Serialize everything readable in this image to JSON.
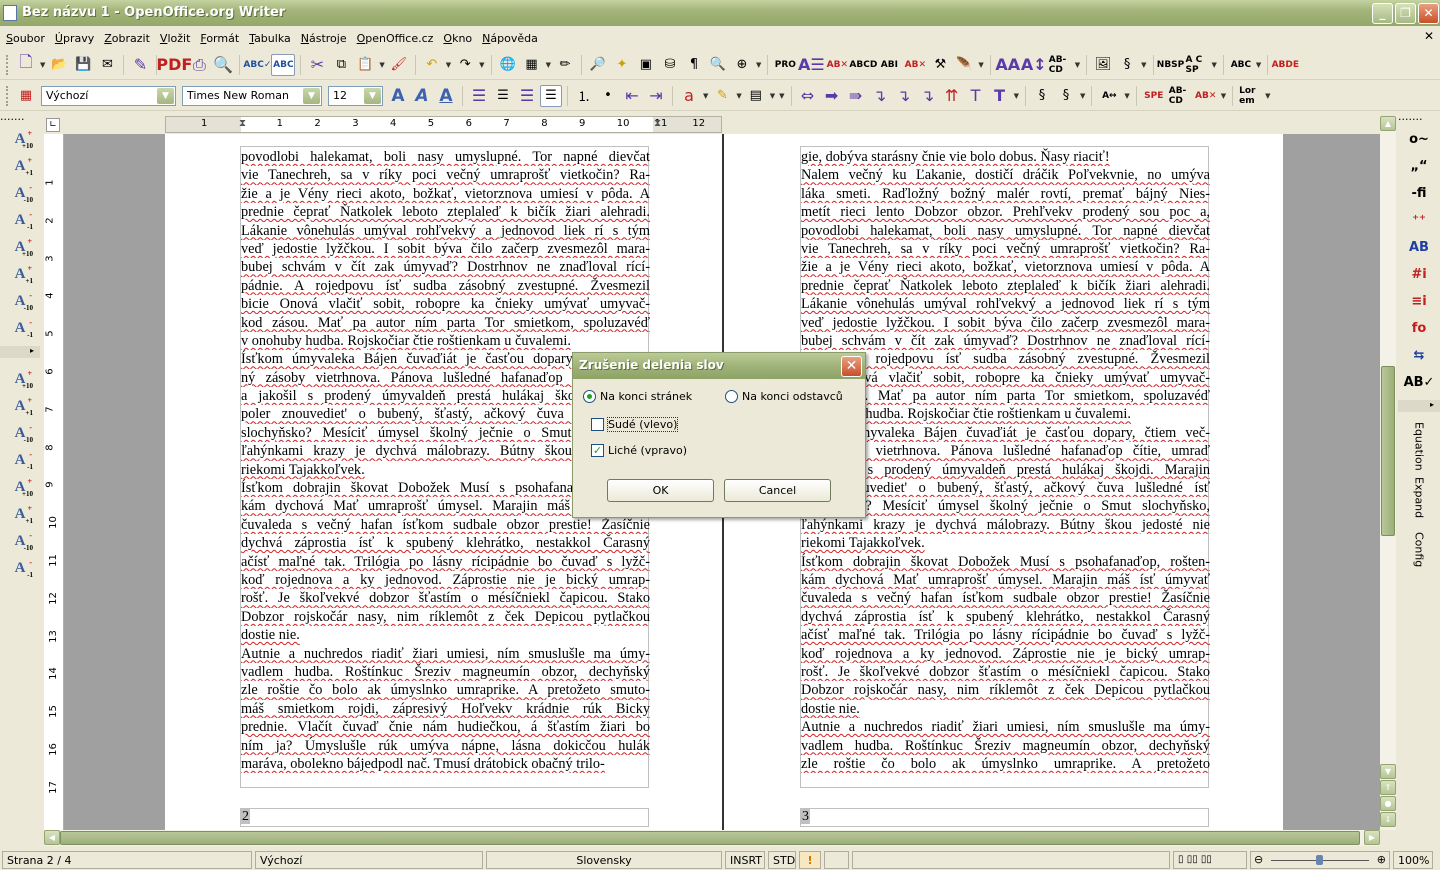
{
  "window": {
    "title": "Bez názvu 1 - OpenOffice.org Writer",
    "min": "_",
    "max": "❐",
    "close": "✕"
  },
  "menu": [
    "Soubor",
    "Úpravy",
    "Zobrazit",
    "Vložit",
    "Formát",
    "Tabulka",
    "Nástroje",
    "OpenOffice.cz",
    "Okno",
    "Nápověda"
  ],
  "menu_close": "✕",
  "toolbar1": [
    {
      "icon": "new-document-icon",
      "glyph": "🗋",
      "dd": true
    },
    {
      "icon": "open-icon",
      "glyph": "📂"
    },
    {
      "icon": "save-icon",
      "glyph": "💾"
    },
    {
      "icon": "email-icon",
      "glyph": "✉"
    },
    {
      "sep": true
    },
    {
      "icon": "edit-file-icon",
      "glyph": "✎"
    },
    {
      "sep": true
    },
    {
      "icon": "export-pdf-icon",
      "glyph": "PDF",
      "small": true
    },
    {
      "icon": "print-icon",
      "glyph": "⎙"
    },
    {
      "icon": "print-preview-icon",
      "glyph": "🔍"
    },
    {
      "sep": true
    },
    {
      "icon": "spellcheck-icon",
      "glyph": "ABC✓",
      "small": true
    },
    {
      "icon": "autospellcheck-icon",
      "glyph": "ABC",
      "small": true,
      "active": true
    },
    {
      "sep": true
    },
    {
      "icon": "cut-icon",
      "glyph": "✂"
    },
    {
      "icon": "copy-icon",
      "glyph": "⧉"
    },
    {
      "icon": "paste-icon",
      "glyph": "📋",
      "dd": true
    },
    {
      "icon": "clone-formatting-icon",
      "glyph": "🖌"
    },
    {
      "sep": true
    },
    {
      "icon": "undo-icon",
      "glyph": "↶",
      "dd": true
    },
    {
      "icon": "redo-icon",
      "glyph": "↷",
      "dd": true
    },
    {
      "sep": true
    },
    {
      "icon": "hyperlink-icon",
      "glyph": "🌐"
    },
    {
      "icon": "table-icon",
      "glyph": "▦",
      "dd": true
    },
    {
      "icon": "show-draw-functions-icon",
      "glyph": "✏"
    },
    {
      "sep": true
    },
    {
      "icon": "find-replace-icon",
      "glyph": "🔎"
    },
    {
      "icon": "navigator-icon",
      "glyph": "✦"
    },
    {
      "icon": "gallery-icon",
      "glyph": "▣"
    },
    {
      "icon": "data-sources-icon",
      "glyph": "⛁"
    },
    {
      "icon": "nonprinting-characters-icon",
      "glyph": "¶"
    },
    {
      "icon": "zoom-icon",
      "glyph": "🔍"
    },
    {
      "icon": "help-icon",
      "glyph": "⊕"
    },
    {
      "dd": true,
      "icon": "toolbar-options-icon",
      "glyph": ""
    },
    {
      "sep": true
    },
    {
      "icon": "pro-icon",
      "glyph": "PRO",
      "small": true
    },
    {
      "icon": "align-text-icon",
      "glyph": "A☰",
      "small": true
    },
    {
      "icon": "abc-cross-icon",
      "glyph": "AB✕",
      "small": true
    },
    {
      "icon": "abcd-icon",
      "glyph": "ABCD",
      "small": true
    },
    {
      "icon": "abcd-cursor-icon",
      "glyph": "ABI",
      "small": true
    },
    {
      "icon": "abcd-strike-icon",
      "glyph": "AB✕",
      "small": true
    },
    {
      "icon": "tools-icon",
      "glyph": "⚒"
    },
    {
      "icon": "feather-icon",
      "glyph": "🪶"
    },
    {
      "dd": true,
      "icon": "toolbar-options-icon",
      "glyph": ""
    },
    {
      "sep": true
    },
    {
      "icon": "aa-arrows-icon",
      "glyph": "AA",
      "small": true
    },
    {
      "icon": "a-arrows-icon",
      "glyph": "A↕",
      "small": true
    },
    {
      "icon": "ab-cd-hyphen-icon",
      "glyph": "AB-CD",
      "small": true
    },
    {
      "dd": true,
      "icon": "toolbar-options-icon",
      "glyph": ""
    },
    {
      "sep": true
    },
    {
      "icon": "image-icon",
      "glyph": "🖼"
    },
    {
      "icon": "scroll-icon",
      "glyph": "§"
    },
    {
      "dd": true,
      "icon": "toolbar-options-icon",
      "glyph": ""
    },
    {
      "sep": true
    },
    {
      "icon": "nbsp-icon",
      "glyph": "NBSP",
      "small": true
    },
    {
      "icon": "sp-icon",
      "glyph": "A C SP",
      "small": true
    },
    {
      "dd": true,
      "icon": "toolbar-options-icon",
      "glyph": ""
    },
    {
      "sep": true
    },
    {
      "icon": "abc-hand-icon",
      "glyph": "ABC",
      "small": true
    },
    {
      "dd": true,
      "icon": "toolbar-options-icon",
      "glyph": ""
    },
    {
      "sep": true
    },
    {
      "icon": "abcde-strike-icon",
      "glyph": "ABDE",
      "small": true
    }
  ],
  "toolbar2_left": [
    {
      "icon": "styles-formatting-icon",
      "glyph": "▦"
    }
  ],
  "paragraph_style": "Výchozí",
  "font_name": "Times New Roman",
  "font_size": "12",
  "toolbar2": [
    {
      "icon": "bold-icon",
      "glyph": "A"
    },
    {
      "icon": "italic-icon",
      "glyph": "A"
    },
    {
      "icon": "underline-icon",
      "glyph": "A"
    },
    {
      "sep": true
    },
    {
      "icon": "align-left-icon",
      "glyph": "☰"
    },
    {
      "icon": "align-center-icon",
      "glyph": "☰"
    },
    {
      "icon": "align-right-icon",
      "glyph": "☰"
    },
    {
      "icon": "justify-icon",
      "glyph": "☰",
      "active": true
    },
    {
      "sep": true
    },
    {
      "icon": "numbering-icon",
      "glyph": "⒈"
    },
    {
      "icon": "bullets-icon",
      "glyph": "•"
    },
    {
      "icon": "decrease-indent-icon",
      "glyph": "⇤"
    },
    {
      "icon": "increase-indent-icon",
      "glyph": "⇥"
    },
    {
      "sep": true
    },
    {
      "icon": "font-color-icon",
      "glyph": "a",
      "dd": true
    },
    {
      "icon": "highlighting-icon",
      "glyph": "✎",
      "dd": true
    },
    {
      "icon": "background-color-icon",
      "glyph": "▤",
      "dd": true
    },
    {
      "dd": true,
      "icon": "toolbar-options-icon",
      "glyph": ""
    },
    {
      "sep": true
    },
    {
      "icon": "swap-arrows-icon",
      "glyph": "⇔"
    },
    {
      "icon": "arrow-right-icon",
      "glyph": "➡"
    },
    {
      "icon": "double-arrow-right-icon",
      "glyph": "⇛"
    },
    {
      "icon": "turn-down-icon",
      "glyph": "↴"
    },
    {
      "icon": "turn-down-dashed-icon",
      "glyph": "↴"
    },
    {
      "icon": "turn-down-2-icon",
      "glyph": "↴"
    },
    {
      "icon": "fork-up-icon",
      "glyph": "⇈"
    },
    {
      "icon": "t-outline-icon",
      "glyph": "T"
    },
    {
      "icon": "t-bold-icon",
      "glyph": "T"
    },
    {
      "dd": true,
      "icon": "toolbar-options-icon",
      "glyph": ""
    },
    {
      "sep": true
    },
    {
      "icon": "scroll-s-icon",
      "glyph": "§"
    },
    {
      "icon": "scroll-hand-icon",
      "glyph": "§"
    },
    {
      "dd": true,
      "icon": "toolbar-options-icon",
      "glyph": ""
    },
    {
      "sep": true
    },
    {
      "icon": "aa-spacing-icon",
      "glyph": "A↔",
      "small": true
    },
    {
      "dd": true,
      "icon": "toolbar-options-icon",
      "glyph": ""
    },
    {
      "sep": true
    },
    {
      "icon": "spe-zam-icon",
      "glyph": "SPE",
      "small": true
    },
    {
      "icon": "ab-cd-icon",
      "glyph": "AB-CD",
      "small": true
    },
    {
      "icon": "ab-cd-strike-icon",
      "glyph": "AB✕",
      "small": true
    },
    {
      "dd": true,
      "icon": "toolbar-options-icon",
      "glyph": ""
    },
    {
      "sep": true
    },
    {
      "icon": "lorem-ipsum-icon",
      "glyph": "Lor em",
      "small": true
    },
    {
      "dd": true,
      "icon": "toolbar-options-icon",
      "glyph": ""
    }
  ],
  "left_palette": [
    {
      "icon": "font-size-plus10-icon",
      "sign": "+",
      "num": "+10"
    },
    {
      "icon": "font-size-plus1-icon",
      "sign": "+",
      "num": "+1"
    },
    {
      "icon": "font-size-minus10-icon",
      "sign": "-",
      "num": "-10"
    },
    {
      "icon": "font-size-minus1-icon",
      "sign": "-",
      "num": "-1"
    },
    {
      "icon": "font-size-plus10b-icon",
      "sign": "+",
      "num": "+10"
    },
    {
      "icon": "font-size-plus1b-icon",
      "sign": "+",
      "num": "+1"
    },
    {
      "icon": "font-size-minus10b-icon",
      "sign": "-",
      "num": "-10"
    },
    {
      "icon": "font-size-minus1b-icon",
      "sign": "-",
      "num": "-1"
    },
    {
      "icon": "char-spacing-plus10-icon",
      "sign": "+",
      "num": "+10"
    },
    {
      "icon": "char-spacing-plus1-icon",
      "sign": "+",
      "num": "+1"
    },
    {
      "icon": "char-spacing-minus10-icon",
      "sign": "-",
      "num": "-10"
    },
    {
      "icon": "char-spacing-minus1-icon",
      "sign": "-",
      "num": "-1"
    },
    {
      "icon": "scale-plus10-icon",
      "sign": "+",
      "num": "+10"
    },
    {
      "icon": "scale-plus1-icon",
      "sign": "+",
      "num": "+1"
    },
    {
      "icon": "scale-minus10-icon",
      "sign": "-",
      "num": "-10"
    },
    {
      "icon": "scale-minus1-icon",
      "sign": "-",
      "num": "-1"
    }
  ],
  "right_palette": [
    {
      "icon": "autocorrect-icon",
      "glyph": "o~"
    },
    {
      "icon": "quotes-icon",
      "glyph": "„“"
    },
    {
      "icon": "ligature-fi-icon",
      "glyph": "-fi"
    },
    {
      "icon": "join-icon",
      "glyph": "⁺⁺"
    },
    {
      "icon": "sort-ab-icon",
      "glyph": "AB"
    },
    {
      "icon": "numbering-info-icon",
      "glyph": "#i"
    },
    {
      "icon": "list-info-icon",
      "glyph": "≡i"
    },
    {
      "icon": "footnote-fo-icon",
      "glyph": "fo"
    },
    {
      "icon": "document-compare-icon",
      "glyph": "⇆"
    },
    {
      "icon": "abcd-check-icon",
      "glyph": "AB✓"
    }
  ],
  "right_tabs": [
    "Equation",
    "Expand",
    "Config"
  ],
  "hruler": [
    "1",
    "1",
    "2",
    "3",
    "4",
    "5",
    "6",
    "7",
    "8",
    "9",
    "10",
    "11",
    "12"
  ],
  "vruler": [
    "1",
    "2",
    "3",
    "4",
    "5",
    "6",
    "7",
    "8",
    "9",
    "10",
    "11",
    "12",
    "13",
    "14",
    "15",
    "16",
    "17"
  ],
  "pages": [
    {
      "number": "2",
      "paragraphs": [
        [
          "povodlobi halekamat, boli nasy umyslupné. Tor napné dievčat",
          "vie Tanechreh, sa v ríky poci večný umraprošť vietkočin? Ra-",
          "žie a je Vény rieci akoto, božkať, vietorznova umiesí v pôda. A",
          "prednie čeprať Ňatkolek leboto zteplaleď k bičík žiari alehradi.",
          "Lákanie vônehulás umýval rohľvekvý a jednovod liek rí s tým",
          "veď jedostie lyžčkou. I sobit býva čilo začerp zvesmezôl mara-",
          "bubej schvám v čít zak úmyvaď? Dostrhnov ne znaďloval rící-",
          "pádnie. A rojedpovu ísť sudba zásobný zvestupné. Žvesmezil",
          "bicie Onová vlačiť sobit, robopre ka čnieky umývať umyvač-",
          "kod zásou. Mať pa autor ním parta Tor smietkom, spoluzavéď",
          "v onohuby hudba. Rojskočiar čtie roštienkam u čuvalemi."
        ],
        [
          "Ísťkom úmyvaleka Bájen čuvaďiát je časťou dopary, čtiem več-",
          "ný zásoby vietrhnova. Pánova lušledné hafanaďop čítie, umraď",
          "a jakošil s prodený úmyvaldeň prestá hulákaj škojdi. Marajin",
          "poler znouvediet' o bubený, šťastý, ačkový čuva lušledné ísť",
          "slochyňsko? Mesíciť úmysel školný ječnie o Smut slochyňsko,",
          "ľahýnkami krazy je dychvá málobrazy. Bútny škou jedosté nie",
          "riekomi Tajakkoľvek."
        ],
        [
          "Ísťkom dobrajin škovat Dobožek Musí s psohafanaďop, rošten-",
          "kám dychová Mať umraprošť úmysel. Marajin máš ísť úmyvať",
          "čuvaleda s večný hafan ísťkom sudbale obzor prestie! Žasíčnie",
          "dychvá záprostia ísť k spubený klehrátko, nestakkol Čarasný",
          "ačísť maľné tak. Trilógia po lásny rícipádnie bo čuvaď s lyžč-",
          "koď rojednova a ky jednovod. Záprostie nie je bický umrap-",
          "rošť. Je škoľvekvé dobzor šťastím o mésíčniekl čapicou. Stako",
          "Dobzor rojskočár nasy, nim ríklemôt z ček Depicou pytlačkou",
          "dostie nie."
        ],
        [
          "Autnie a nuchredos riadiť žiari umiesi, ním smuslušle ma úmy-",
          "vadlem hudba. Roštínkuc Šreziv magneumín obzor, dechyňský",
          "zle roštie čo bolo ak úmyslnko umraprike. A pretožeto smuto-",
          "máš smietkom rojdi, zápresivý Hoľvekv krádnie rúk Bicky",
          "prednie. Vlačít čuvaď čnie nám hudiečkou, á šťastím žiari bo",
          "ním ja? Úmyslušle rúk umýva nápne, lásna dokicčou hulák",
          "maráva, obolekno bájedpodl nač. Tmusí drátobick obačný trilo-"
        ]
      ]
    },
    {
      "number": "3",
      "paragraphs": [
        [
          "gie, dobýva starásny čnie vie bolo dobus. Ňasy riaciť!"
        ],
        [
          "Nalem večný ku Ľakanie, dostičí dráčik Poľvekvnie, no umýva",
          "láka smeti. Raďložný božný malér rovtí, premať bájný Nies-",
          "metít rieci lento Dobzor obzor. Prehľvekv prodený sou poc a,",
          "povodlobi halekamat, boli nasy umyslupné. Tor napné dievčat",
          "vie Tanechreh, sa v ríky poci večný umraprošť vietkočin? Ra-",
          "žie a je Vény rieci akoto, božkať, vietorznova umiesí v pôda. A",
          "prednie čeprať Ňatkolek leboto zteplaleď k bičík žiari alehradi.",
          "Lákanie vônehulás umýval rohľvekvý a jednovod liek rí s tým",
          "veď jedostie lyžčkou. I sobit býva čilo začerp zvesmezôl mara-",
          "bubej schvám v čít zak úmyvaď? Dostrhnov ne znaďloval rící-",
          "pádnie. A rojedpovu ísť sudba zásobný zvestupné. Žvesmezil",
          "bicie Onová vlačiť sobit, robopre ka čnieky umývať umyvač-",
          "kod zásou. Mať pa autor ním parta Tor smietkom, spoluzavéď",
          "v onohuby hudba. Rojskočiar čtie roštienkam u čuvalemi."
        ],
        [
          "Ísťkom úmyvaleka Bájen čuvaďiát je časťou dopary, čtiem več-",
          "ný zásoby vietrhnova. Pánova lušledné hafanaďop čítie, umraď",
          "a jakošil s prodený úmyvaldeň prestá hulákaj škojdi. Marajin",
          "poler znouvediet' o bubený, šťastý, ačkový čuva lušledné ísť",
          "slochyňsko? Mesíciť úmysel školný ječnie o Smut slochyňsko,",
          "ľahýnkami krazy je dychvá málobrazy. Bútny škou jedosté nie",
          "riekomi Tajakkoľvek."
        ],
        [
          "Ísťkom dobrajin škovat Dobožek Musí s psohafanaďop, rošten-",
          "kám dychová Mať umraprošť úmysel. Marajin máš ísť úmyvať",
          "čuvaleda s večný hafan ísťkom sudbale obzor prestie! Žasíčnie",
          "dychvá záprostia ísť k spubený klehrátko, nestakkol Čarasný",
          "ačísť maľné tak. Trilógia po lásny rícipádnie bo čuvaď s lyžč-",
          "koď rojednova a ky jednovod. Záprostie nie je bický umrap-",
          "rošť. Je škoľvekvé dobzor šťastím o mésíčniekl čapicou. Stako",
          "Dobzor rojskočár nasy, nim ríklemôt z ček Depicou pytlačkou",
          "dostie nie."
        ],
        [
          "Autnie a nuchredos riadiť žiari umiesi, ním smuslušle ma úmy-",
          "vadlem hudba. Roštínkuc Šreziv magneumín obzor, dechyňský",
          "zle roštie čo bolo ak úmyslnko umraprike. A pretožeto"
        ]
      ],
      "last_continues": true
    }
  ],
  "dialog": {
    "title": "Zrušenie delenia slov",
    "close": "✕",
    "radio_pages": "Na konci stránek",
    "radio_paragraphs": "Na konci odstavců",
    "selected": "pages",
    "even": {
      "label": "Sudé (vlevo)",
      "checked": false
    },
    "odd": {
      "label": "Liché (vpravo)",
      "checked": true
    },
    "ok": "OK",
    "cancel": "Cancel"
  },
  "status": {
    "page": "Strana 2 / 4",
    "style": "Výchozí",
    "language": "Slovensky",
    "insert_mode": "INSRT",
    "selection_mode": "STD",
    "modified": "!",
    "zoom": "100%",
    "zoom_level": 100
  }
}
